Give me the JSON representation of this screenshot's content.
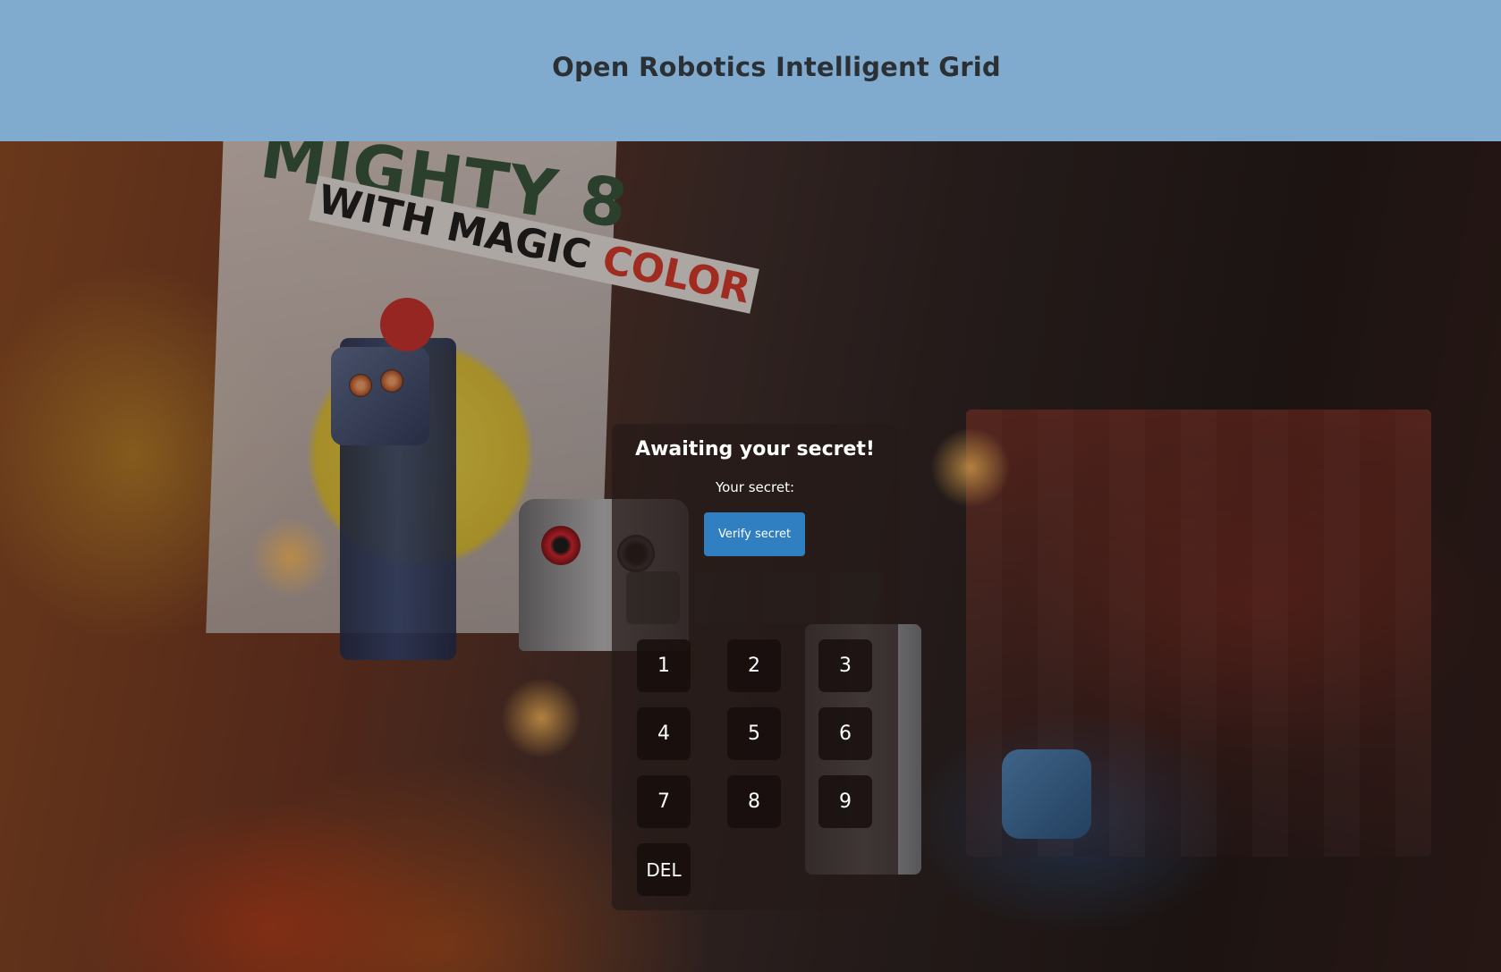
{
  "header": {
    "title": "Open Robotics Intelligent Grid",
    "background_color": "#80abcf"
  },
  "background": {
    "poster_line_1": "MIGHTY 8",
    "poster_line_2_prefix": "WITH MAGIC ",
    "poster_line_2_accent": "COLOR"
  },
  "panel": {
    "title": "Awaiting your secret!",
    "secret_label": "Your secret:",
    "verify_button_label": "Verify secret",
    "verify_button_color": "#2f7fc1",
    "digit_slots": [
      "",
      "",
      "",
      ""
    ],
    "keypad": {
      "k1": "1",
      "k2": "2",
      "k3": "3",
      "k4": "4",
      "k5": "5",
      "k6": "6",
      "k7": "7",
      "k8": "8",
      "k9": "9",
      "del": "DEL"
    }
  }
}
